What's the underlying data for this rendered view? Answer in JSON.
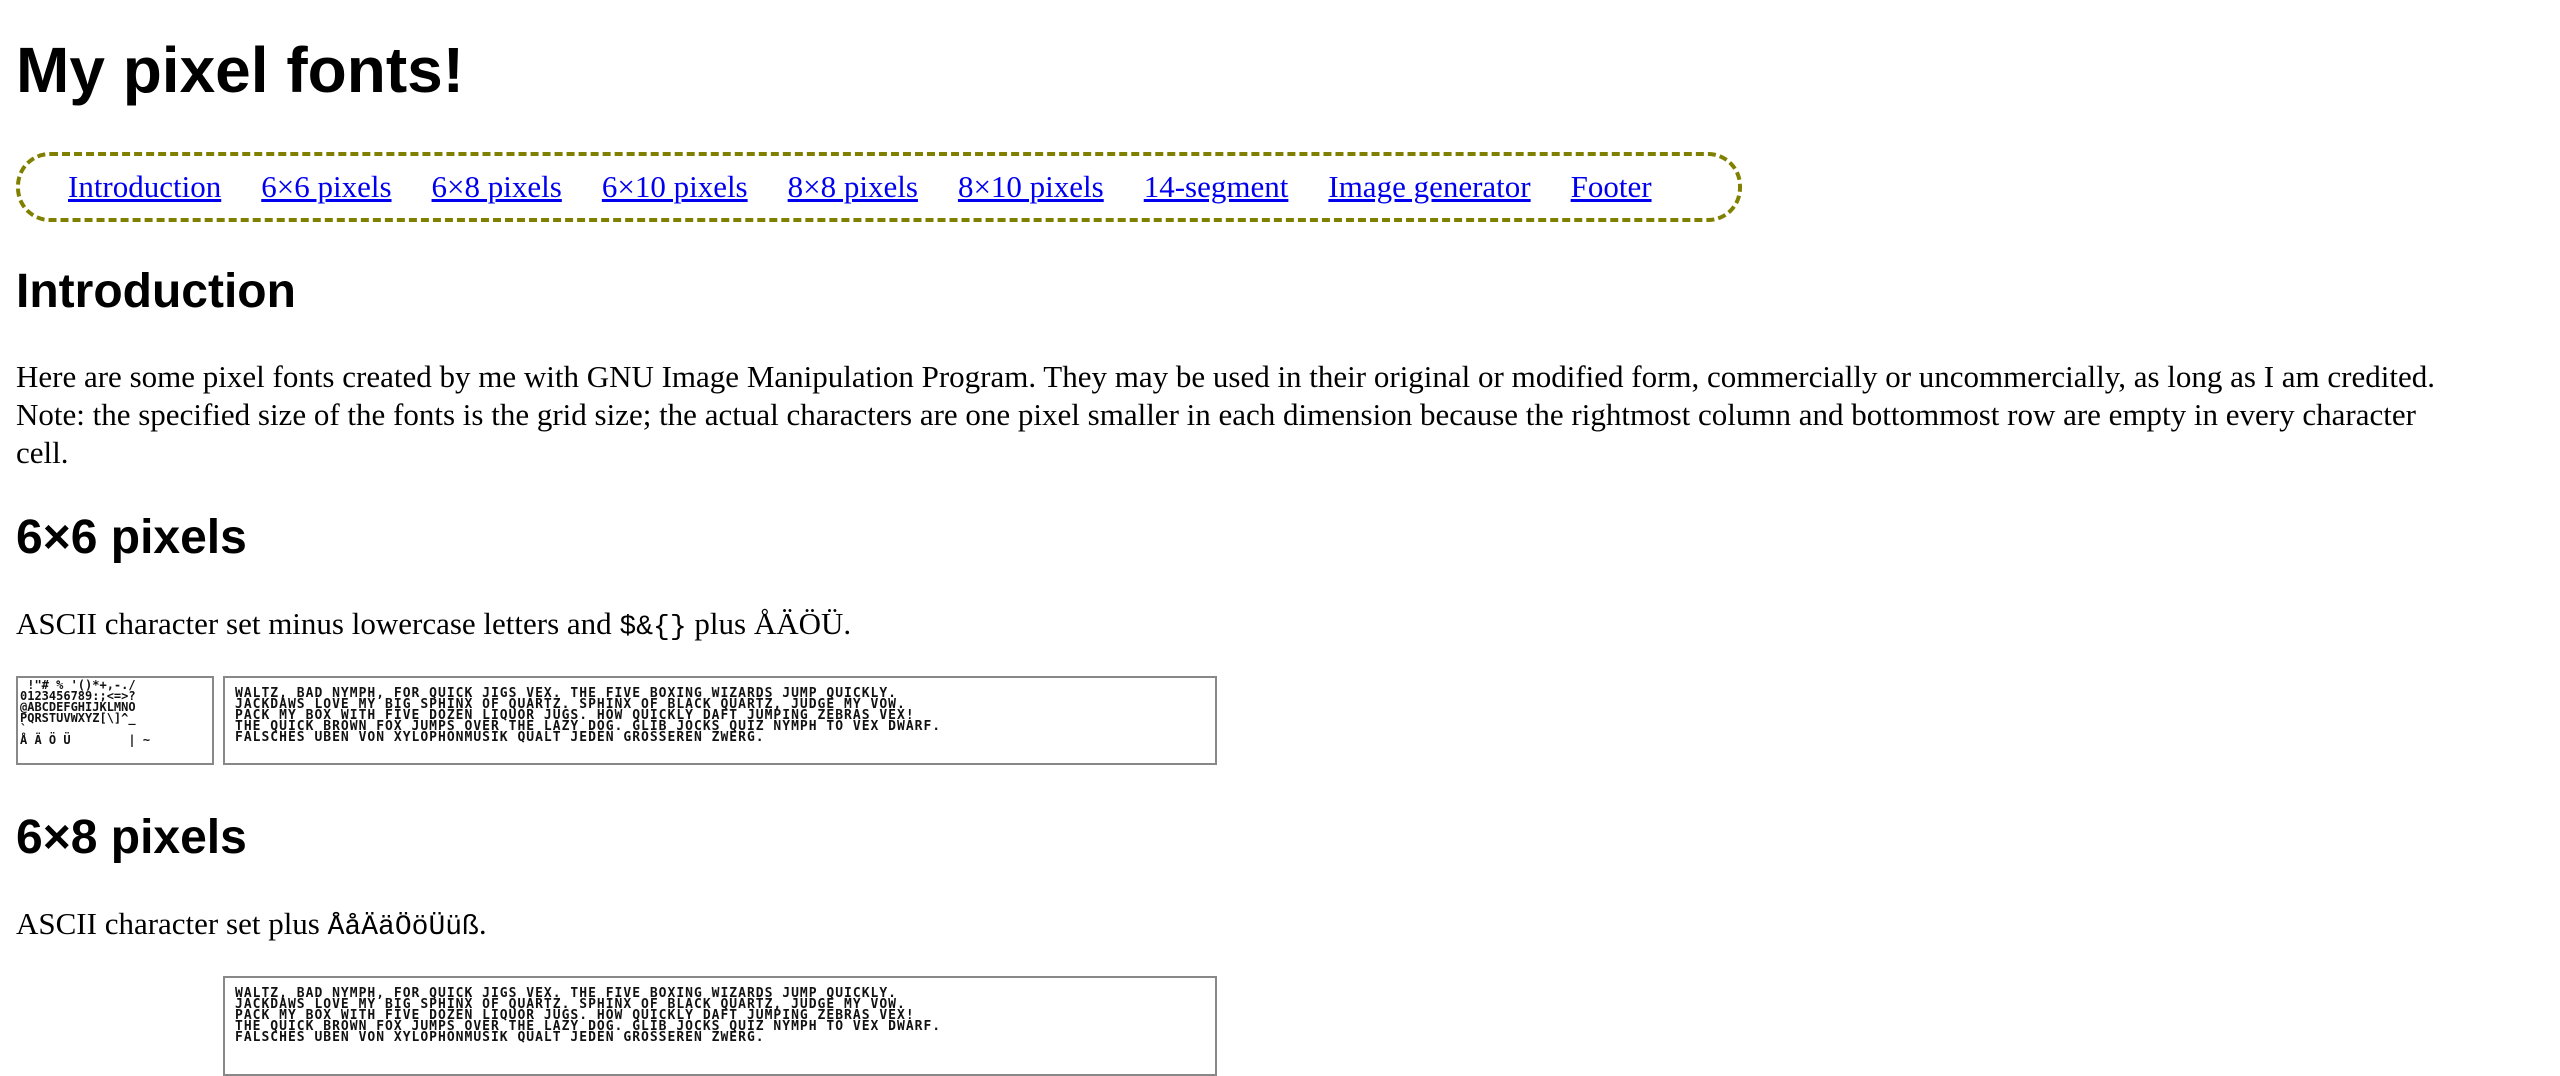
{
  "title": "My pixel fonts!",
  "nav": [
    "Introduction",
    "6×6 pixels",
    "6×8 pixels",
    "6×10 pixels",
    "8×8 pixels",
    "8×10 pixels",
    "14-segment",
    "Image generator",
    "Footer"
  ],
  "intro": {
    "heading": "Introduction",
    "line1": "Here are some pixel fonts created by me with GNU Image Manipulation Program. They may be used in their original or modified form, commercially or uncommercially, as long as I am credited.",
    "line2": "Note: the specified size of the fonts is the grid size; the actual characters are one pixel smaller in each dimension because the rightmost column and bottommost row are empty in every character",
    "line3": "cell."
  },
  "s6x6": {
    "heading": "6×6 pixels",
    "desc_before": "ASCII character set minus lowercase letters and ",
    "desc_code": "$&{}",
    "desc_after": " plus ÅÄÖÜ.",
    "charset": [
      " !\"# % '()*+,-./",
      "0123456789:;<=>?",
      "@ABCDEFGHIJKLMNO",
      "PQRSTUVWXYZ[\\]^_",
      "`",
      "Å Ä Ö Ü        | ~"
    ],
    "sample": [
      "WALTZ, BAD NYMPH, FOR QUICK JIGS VEX. THE FIVE BOXING WIZARDS JUMP QUICKLY.",
      "JACKDAWS LOVE MY BIG SPHINX OF QUARTZ. SPHINX OF BLACK QUARTZ, JUDGE MY VOW.",
      "PACK MY BOX WITH FIVE DOZEN LIQUOR JUGS. HOW QUICKLY DAFT JUMPING ZEBRAS VEX!",
      "THE QUICK BROWN FOX JUMPS OVER THE LAZY DOG. GLIB JOCKS QUIZ NYMPH TO VEX DWARF.",
      "FALSCHES UBEN VON XYLOPHONMUSIK QUALT JEDEN GROSSEREN ZWERG."
    ]
  },
  "s6x8": {
    "heading": "6×8 pixels",
    "desc_before": "ASCII character set plus ",
    "desc_code": "ÅåÄäÖöÜüß",
    "desc_after": ".",
    "sample": [
      "WALTZ, BAD NYMPH, FOR QUICK JIGS VEX. THE FIVE BOXING WIZARDS JUMP QUICKLY.",
      "JACKDAWS LOVE MY BIG SPHINX OF QUARTZ. SPHINX OF BLACK QUARTZ, JUDGE MY VOW.",
      "PACK MY BOX WITH FIVE DOZEN LIQUOR JUGS. HOW QUICKLY DAFT JUMPING ZEBRAS VEX!",
      "THE QUICK BROWN FOX JUMPS OVER THE LAZY DOG. GLIB JOCKS QUIZ NYMPH TO VEX DWARF.",
      "FALSCHES UBEN VON XYLOPHONMUSIK QUALT JEDEN GROSSEREN ZWERG."
    ]
  },
  "colors": {
    "link": "#0000ee",
    "nav_border": "#808000",
    "image_border": "#888888"
  }
}
